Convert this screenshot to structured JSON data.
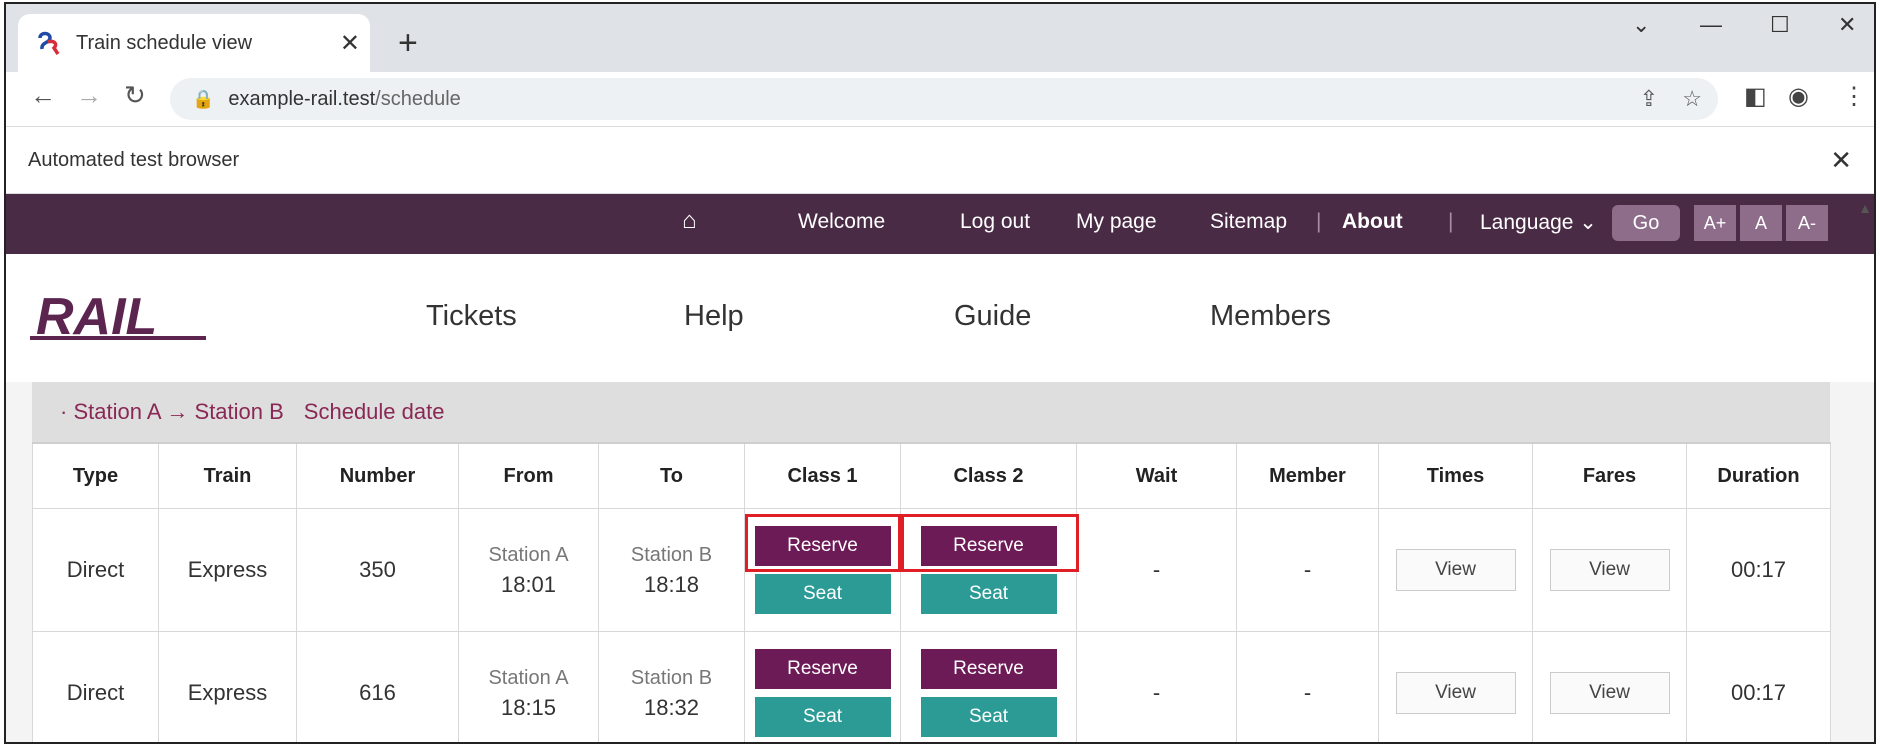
{
  "browser": {
    "tab_title": "Train schedule view",
    "url_host": "example-rail.test",
    "url_path": "/schedule",
    "automation_notice": "Automated test browser"
  },
  "site": {
    "topbar": {
      "welcome": "Welcome",
      "logout": "Log out",
      "mypage": "My page",
      "sitemap": "Sitemap",
      "company": "About",
      "language": "Language",
      "move": "Go",
      "font_up": "A+",
      "font_normal": "A",
      "font_down": "A-"
    },
    "logo_text": "RAIL",
    "gnb": [
      "Tickets",
      "Help",
      "Guide",
      "Members"
    ]
  },
  "route": {
    "path": "· Station A → Station B",
    "date": "Schedule date"
  },
  "table": {
    "headers": [
      "Type",
      "Train",
      "Number",
      "From",
      "To",
      "Class 1",
      "Class 2",
      "Wait",
      "Member",
      "Times",
      "Fares",
      "Duration"
    ],
    "rows": [
      {
        "type": "Direct",
        "train": "Express",
        "number": "350",
        "dep_station": "Station A",
        "dep_time": "18:01",
        "arr_station": "Station B",
        "arr_time": "18:18",
        "special_reserve": "Reserve",
        "special_seat": "Seat",
        "general_reserve": "Reserve",
        "general_seat": "Seat",
        "waitlist": "-",
        "member_discount": "-",
        "schedule_view": "View",
        "fare_view": "View",
        "duration": "00:17"
      },
      {
        "type": "Direct",
        "train": "Express",
        "number": "616",
        "dep_station": "Station A",
        "dep_time": "18:15",
        "arr_station": "Station B",
        "arr_time": "18:32",
        "special_reserve": "Reserve",
        "special_seat": "Seat",
        "general_reserve": "Reserve",
        "general_seat": "Seat",
        "waitlist": "-",
        "member_discount": "-",
        "schedule_view": "View",
        "fare_view": "View",
        "duration": "00:17"
      }
    ]
  },
  "colors": {
    "topbar_bg": "#4a2b45",
    "reserve_btn": "#6d1b57",
    "seat_btn": "#2d9b95",
    "route_text": "#8a2855",
    "highlight": "#e01e26"
  },
  "icons": [
    "favicon",
    "close-icon",
    "plus-icon",
    "back-icon",
    "forward-icon",
    "reload-icon",
    "lock-icon",
    "share-icon",
    "star-icon",
    "sidepanel-icon",
    "profile-icon",
    "menu-icon",
    "home-icon",
    "chevron-down-icon"
  ]
}
